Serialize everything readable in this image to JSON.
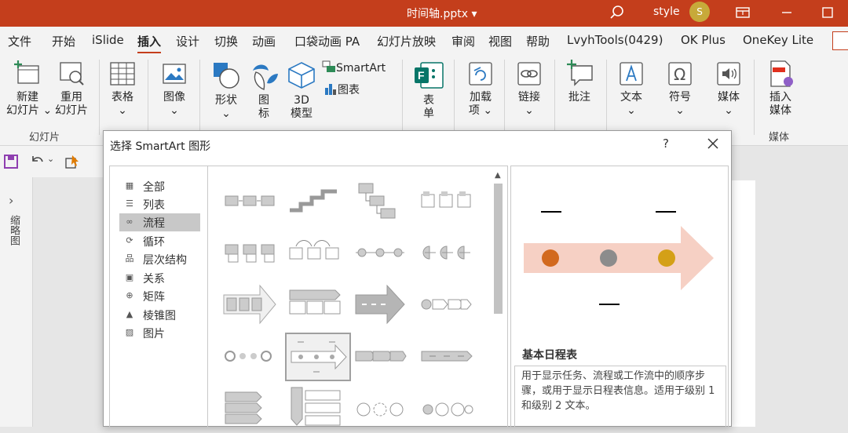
{
  "titlebar": {
    "document": "时间轴.pptx",
    "user_name": "style",
    "avatar_initial": "S",
    "accent_color": "#c43e1c"
  },
  "tabs": [
    "文件",
    "开始",
    "iSlide",
    "插入",
    "设计",
    "切换",
    "动画",
    "口袋动画 PA",
    "幻灯片放映",
    "审阅",
    "视图",
    "帮助",
    "LvyhTools(0429)",
    "OK Plus",
    "OneKey Lite"
  ],
  "active_tab": "插入",
  "ribbon": {
    "new_slide": "新建",
    "new_slide_2": "幻灯片",
    "reuse_slide": "重用",
    "reuse_slide_2": "幻灯片",
    "group_slides": "幻灯片",
    "table": "表格",
    "image": "图像",
    "shapes": "形状",
    "icons": "图",
    "icons_2": "标",
    "model_3d": "3D",
    "model_3d_2": "模型",
    "smartart": "SmartArt",
    "chart": "图表",
    "form": "表",
    "form_2": "单",
    "addins": "加载",
    "addins_2": "项",
    "link": "链接",
    "comment": "批注",
    "text": "文本",
    "symbols": "符号",
    "media": "媒体",
    "insert_media": "插入",
    "insert_media_2": "媒体",
    "group_media": "媒体"
  },
  "sidebar": {
    "label": "缩略图"
  },
  "dialog": {
    "title": "选择 SmartArt 图形",
    "help": "?",
    "categories": [
      {
        "icon": "all-icon",
        "label": "全部"
      },
      {
        "icon": "list-icon",
        "label": "列表"
      },
      {
        "icon": "process-icon",
        "label": "流程"
      },
      {
        "icon": "cycle-icon",
        "label": "循环"
      },
      {
        "icon": "hierarchy-icon",
        "label": "层次结构"
      },
      {
        "icon": "relationship-icon",
        "label": "关系"
      },
      {
        "icon": "matrix-icon",
        "label": "矩阵"
      },
      {
        "icon": "pyramid-icon",
        "label": "棱锥图"
      },
      {
        "icon": "picture-icon",
        "label": "图片"
      }
    ],
    "selected_category": "流程",
    "preview_title": "基本日程表",
    "preview_description": "用于显示任务、流程或工作流中的顺序步骤，或用于显示日程表信息。适用于级别 1 和级别 2 文本。",
    "preview_colors": {
      "arrow": "#f6d0c4",
      "dot_1": "#d2691e",
      "dot_2": "#8c8c8c",
      "dot_3": "#d4a017"
    }
  }
}
